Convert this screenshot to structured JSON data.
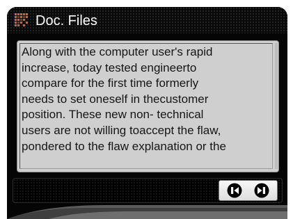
{
  "title_bar": {
    "title": "Doc. Files",
    "icon": "dot-matrix-document-icon"
  },
  "document": {
    "text": "Along with the computer user's rapid\nincrease, today tested engineerto\ncompare for the first time formerly\nneeds to set oneself in thecustomer\nposition. These new non- technical\nusers are not willing toaccept the flaw,\npondered to the flaw explanation or the"
  },
  "navigation": {
    "previous_icon": "previous-page-icon",
    "next_icon": "next-page-icon"
  },
  "colors": {
    "title_text": "#ffffff",
    "icon_accent": "#e85a1a",
    "panel_background": "#cfcfcf",
    "body_text": "#161616",
    "frame_background": "#050505",
    "button_face": "#eeeeee"
  }
}
